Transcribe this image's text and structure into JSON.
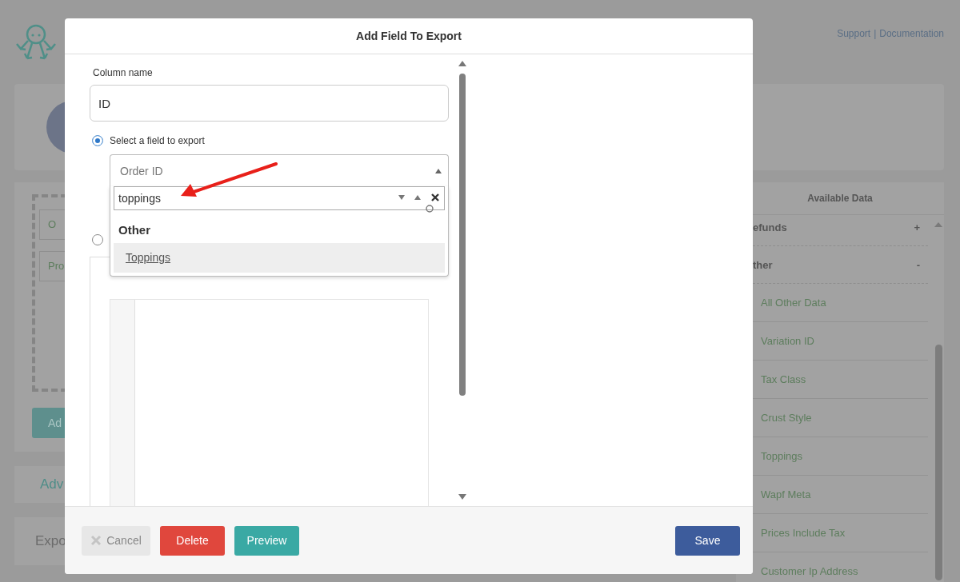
{
  "header": {
    "links": [
      {
        "label": "Support"
      },
      {
        "label": "Documentation"
      }
    ],
    "separator": "|"
  },
  "background": {
    "left_items": [
      "O",
      "Pro"
    ],
    "add_button": "Ad",
    "sections": [
      "Adv",
      "Expo"
    ],
    "available_data": {
      "title": "Available Data",
      "groups": [
        {
          "label": "efunds",
          "sign": "+"
        },
        {
          "label": "ther",
          "sign": "-"
        }
      ],
      "items": [
        "All Other Data",
        "Variation ID",
        "Tax Class",
        "Crust Style",
        "Toppings",
        "Wapf Meta",
        "Prices Include Tax",
        "Customer Ip Address"
      ]
    }
  },
  "modal": {
    "title": "Add Field To Export",
    "column_label": "Column name",
    "column_value": "ID",
    "options": [
      {
        "label": "Select a field to export",
        "selected": true
      },
      {
        "selected": false
      }
    ],
    "select": {
      "value": "Order ID",
      "expanded": true,
      "search": "toppings",
      "groups": [
        {
          "label": "Other",
          "options": [
            {
              "label": "Toppings",
              "selected": true
            }
          ]
        }
      ]
    },
    "buttons": [
      {
        "label": "Cancel",
        "kind": "cancel"
      },
      {
        "label": "Delete",
        "kind": "danger"
      },
      {
        "label": "Preview",
        "kind": "preview"
      },
      {
        "label": "Save",
        "kind": "primary"
      }
    ]
  }
}
